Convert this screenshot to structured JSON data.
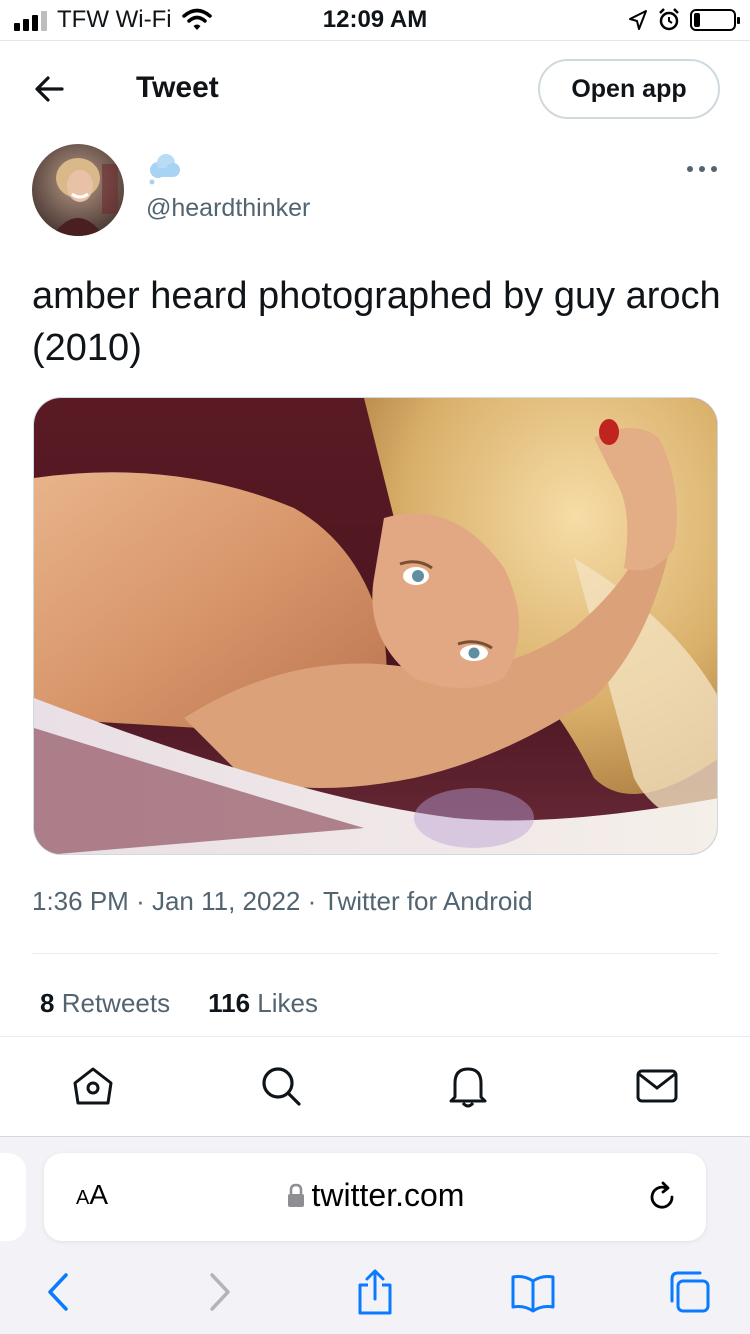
{
  "status_bar": {
    "carrier": "TFW Wi-Fi",
    "time": "12:09 AM",
    "battery_level": 0.15
  },
  "header": {
    "title": "Tweet",
    "open_app_label": "Open app"
  },
  "tweet": {
    "handle": "@heardthinker",
    "text": "amber heard photographed by guy aroch (2010)",
    "time": "1:36 PM",
    "date": "Jan 11, 2022",
    "source": "Twitter for Android",
    "retweets_count": "8",
    "retweets_label": "Retweets",
    "likes_count": "116",
    "likes_label": "Likes"
  },
  "bottom_nav": {
    "items": [
      "home-icon",
      "search-icon",
      "notifications-icon",
      "messages-icon"
    ]
  },
  "browser": {
    "text_size_label_small": "A",
    "text_size_label_large": "A",
    "url": "twitter.com"
  },
  "colors": {
    "text_primary": "#0f1419",
    "text_secondary": "#536471",
    "safari_blue": "#0a7aff",
    "border": "#cfd9de"
  }
}
